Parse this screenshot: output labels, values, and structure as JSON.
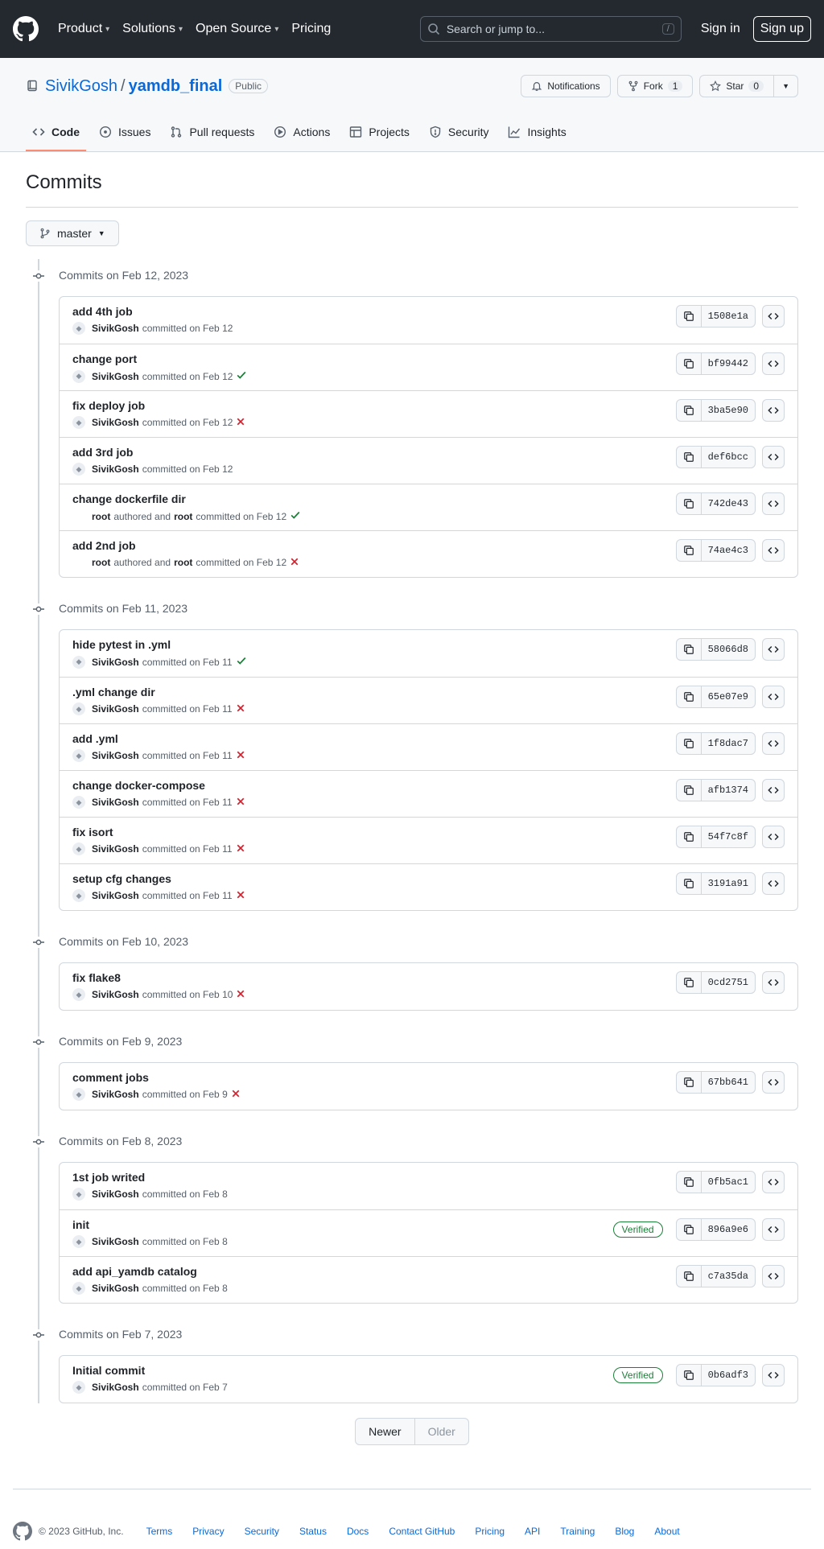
{
  "header": {
    "nav": [
      "Product",
      "Solutions",
      "Open Source",
      "Pricing"
    ],
    "search_placeholder": "Search or jump to...",
    "search_shortcut": "/",
    "signin": "Sign in",
    "signup": "Sign up"
  },
  "repo": {
    "owner": "SivikGosh",
    "separator": "/",
    "name": "yamdb_final",
    "visibility": "Public",
    "notifications_label": "Notifications",
    "fork_label": "Fork",
    "fork_count": "1",
    "star_label": "Star",
    "star_count": "0"
  },
  "tabs": [
    "Code",
    "Issues",
    "Pull requests",
    "Actions",
    "Projects",
    "Security",
    "Insights"
  ],
  "page_title": "Commits",
  "branch": "master",
  "groups": [
    {
      "heading": "Commits on Feb 12, 2023",
      "commits": [
        {
          "title": "add 4th job",
          "author": "SivikGosh",
          "text": "committed on Feb 12",
          "status": "",
          "sha": "1508e1a"
        },
        {
          "title": "change port",
          "author": "SivikGosh",
          "text": "committed on Feb 12",
          "status": "ok",
          "sha": "bf99442"
        },
        {
          "title": "fix deploy job",
          "author": "SivikGosh",
          "text": "committed on Feb 12",
          "status": "fail",
          "sha": "3ba5e90"
        },
        {
          "title": "add 3rd job",
          "author": "SivikGosh",
          "text": "committed on Feb 12",
          "status": "",
          "sha": "def6bcc"
        },
        {
          "title": "change dockerfile dir",
          "author": "root",
          "mid": "authored and",
          "coauthor": "root",
          "text": "committed on Feb 12",
          "status": "ok",
          "sha": "742de43",
          "no_avatar": true
        },
        {
          "title": "add 2nd job",
          "author": "root",
          "mid": "authored and",
          "coauthor": "root",
          "text": "committed on Feb 12",
          "status": "fail",
          "sha": "74ae4c3",
          "no_avatar": true
        }
      ]
    },
    {
      "heading": "Commits on Feb 11, 2023",
      "commits": [
        {
          "title": "hide pytest in .yml",
          "author": "SivikGosh",
          "text": "committed on Feb 11",
          "status": "ok",
          "sha": "58066d8"
        },
        {
          "title": ".yml change dir",
          "author": "SivikGosh",
          "text": "committed on Feb 11",
          "status": "fail",
          "sha": "65e07e9"
        },
        {
          "title": "add .yml",
          "author": "SivikGosh",
          "text": "committed on Feb 11",
          "status": "fail",
          "sha": "1f8dac7"
        },
        {
          "title": "change docker-compose",
          "author": "SivikGosh",
          "text": "committed on Feb 11",
          "status": "fail",
          "sha": "afb1374"
        },
        {
          "title": "fix isort",
          "author": "SivikGosh",
          "text": "committed on Feb 11",
          "status": "fail",
          "sha": "54f7c8f"
        },
        {
          "title": "setup cfg changes",
          "author": "SivikGosh",
          "text": "committed on Feb 11",
          "status": "fail",
          "sha": "3191a91"
        }
      ]
    },
    {
      "heading": "Commits on Feb 10, 2023",
      "commits": [
        {
          "title": "fix flake8",
          "author": "SivikGosh",
          "text": "committed on Feb 10",
          "status": "fail",
          "sha": "0cd2751"
        }
      ]
    },
    {
      "heading": "Commits on Feb 9, 2023",
      "commits": [
        {
          "title": "comment jobs",
          "author": "SivikGosh",
          "text": "committed on Feb 9",
          "status": "fail",
          "sha": "67bb641"
        }
      ]
    },
    {
      "heading": "Commits on Feb 8, 2023",
      "commits": [
        {
          "title": "1st job writed",
          "author": "SivikGosh",
          "text": "committed on Feb 8",
          "status": "",
          "sha": "0fb5ac1"
        },
        {
          "title": "init",
          "author": "SivikGosh",
          "text": "committed on Feb 8",
          "status": "",
          "sha": "896a9e6",
          "verified": "Verified"
        },
        {
          "title": "add api_yamdb catalog",
          "author": "SivikGosh",
          "text": "committed on Feb 8",
          "status": "",
          "sha": "c7a35da"
        }
      ]
    },
    {
      "heading": "Commits on Feb 7, 2023",
      "commits": [
        {
          "title": "Initial commit",
          "author": "SivikGosh",
          "text": "committed on Feb 7",
          "status": "",
          "sha": "0b6adf3",
          "verified": "Verified"
        }
      ]
    }
  ],
  "pager": {
    "newer": "Newer",
    "older": "Older"
  },
  "footer": {
    "copyright": "© 2023 GitHub, Inc.",
    "links": [
      "Terms",
      "Privacy",
      "Security",
      "Status",
      "Docs",
      "Contact GitHub",
      "Pricing",
      "API",
      "Training",
      "Blog",
      "About"
    ]
  },
  "colors": {
    "success": "#1a7f37",
    "failure": "#cf222e",
    "link": "#0969da",
    "header_bg": "#24292f",
    "active_tab": "#fd8c73"
  }
}
